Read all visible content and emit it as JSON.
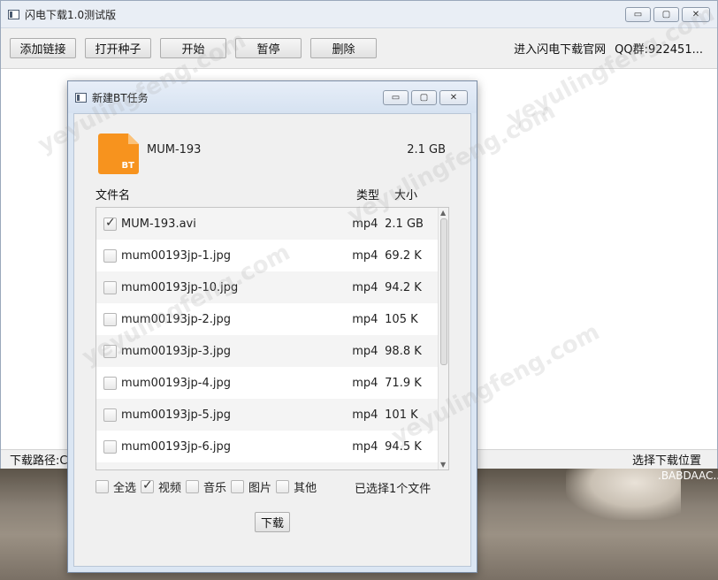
{
  "main_window": {
    "title": "闪电下载1.0测试版",
    "controls": [
      "▭",
      "▢",
      "✕"
    ]
  },
  "toolbar": {
    "buttons": [
      "添加链接",
      "打开种子",
      "开始",
      "暂停",
      "删除"
    ],
    "official_site": "进入闪电下载官网",
    "qq_group": "QQ群:922451..."
  },
  "statusbar": {
    "download_path": "下载路径:C:",
    "choose_location": "选择下载位置"
  },
  "dialog": {
    "title": "新建BT任务",
    "icon_text": "BT",
    "torrent_name": "MUM-193",
    "torrent_size": "2.1 GB",
    "columns": {
      "name": "文件名",
      "type": "类型",
      "size": "大小"
    },
    "files": [
      {
        "name": "MUM-193.avi",
        "type": "mp4",
        "size": "2.1 GB",
        "checked": true
      },
      {
        "name": "mum00193jp-1.jpg",
        "type": "mp4",
        "size": "69.2 K",
        "checked": false
      },
      {
        "name": "mum00193jp-10.jpg",
        "type": "mp4",
        "size": "94.2 K",
        "checked": false
      },
      {
        "name": "mum00193jp-2.jpg",
        "type": "mp4",
        "size": "105 K",
        "checked": false
      },
      {
        "name": "mum00193jp-3.jpg",
        "type": "mp4",
        "size": "98.8 K",
        "checked": false
      },
      {
        "name": "mum00193jp-4.jpg",
        "type": "mp4",
        "size": "71.9 K",
        "checked": false
      },
      {
        "name": "mum00193jp-5.jpg",
        "type": "mp4",
        "size": "101 K",
        "checked": false
      },
      {
        "name": "mum00193jp-6.jpg",
        "type": "mp4",
        "size": "94.5 K",
        "checked": false
      }
    ],
    "filters": [
      {
        "label": "全选",
        "checked": false
      },
      {
        "label": "视频",
        "checked": true
      },
      {
        "label": "音乐",
        "checked": false
      },
      {
        "label": "图片",
        "checked": false
      },
      {
        "label": "其他",
        "checked": false
      }
    ],
    "selected_count": "已选择1个文件",
    "download_label": "下载"
  },
  "background": {
    "caption": ".BABDAAC.."
  },
  "watermark": "yeyulingfeng.com"
}
